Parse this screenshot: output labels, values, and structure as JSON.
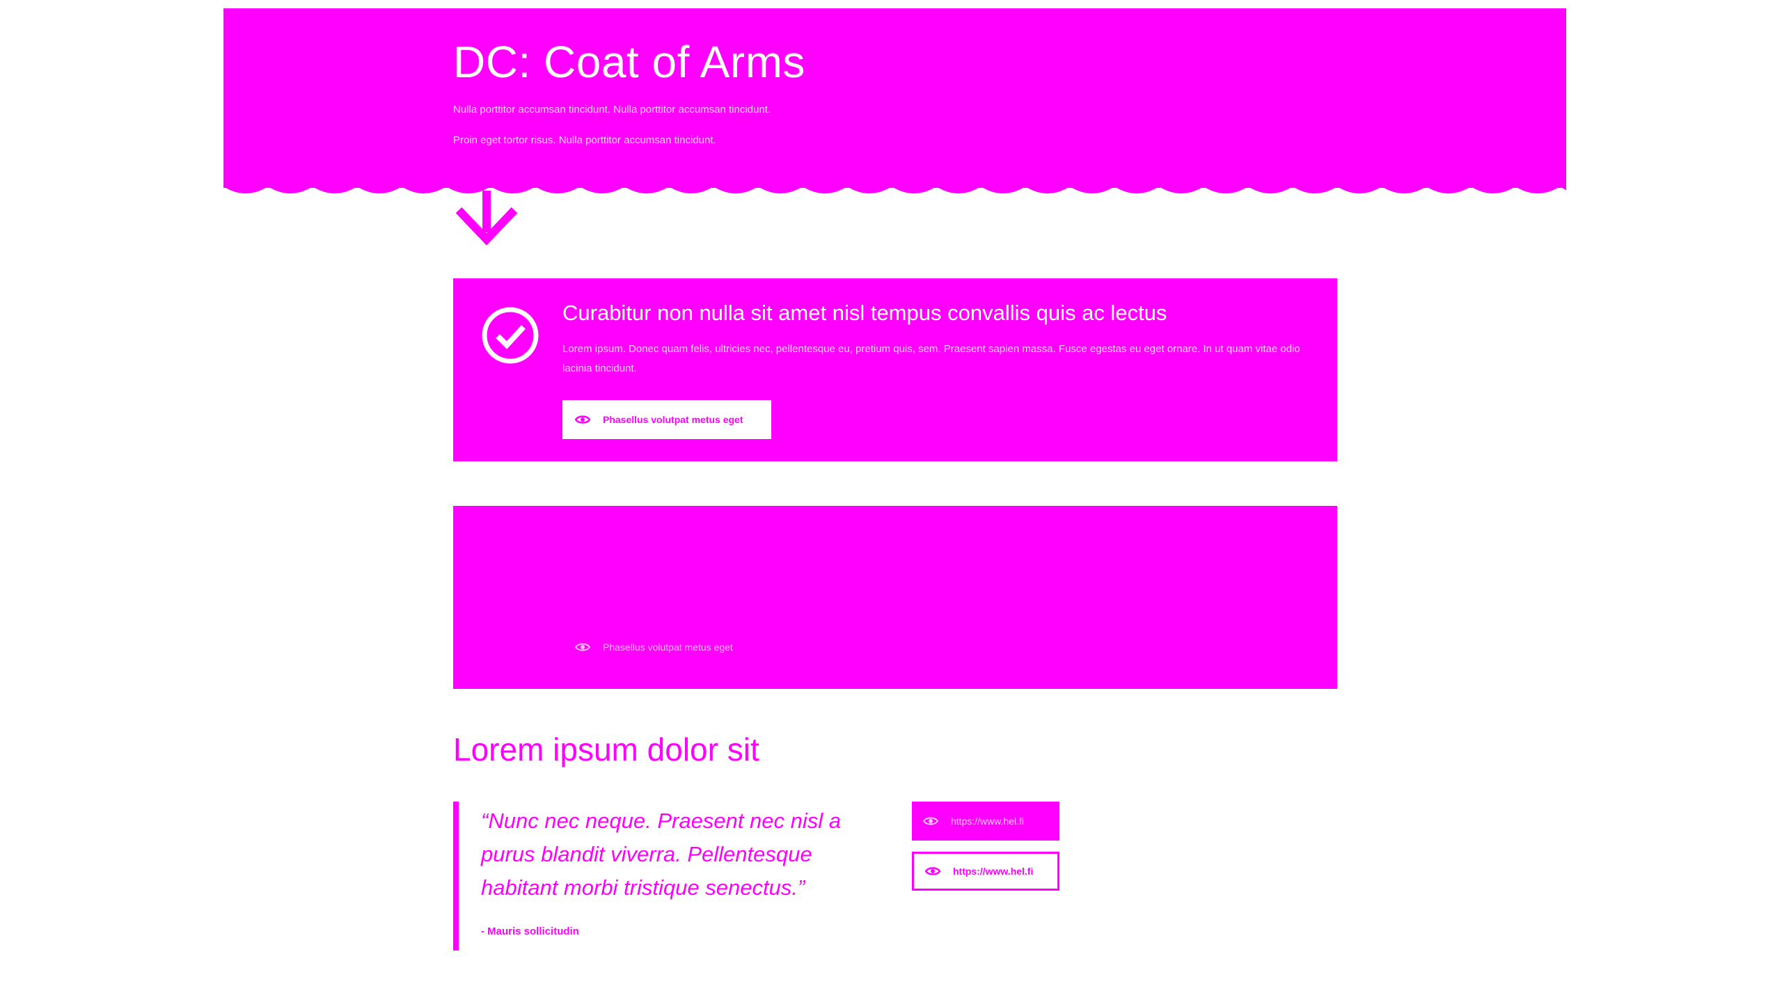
{
  "colors": {
    "brand": "#ff00ff",
    "background": "#ffffff",
    "text_on_brand": "#ffffff"
  },
  "hero": {
    "title": "DC: Coat of Arms",
    "paragraph_1": "Nulla porttitor accumsan tincidunt. Nulla porttitor accumsan tincidunt.",
    "paragraph_2": "Proin eget tortor risus. Nulla porttitor accumsan tincidunt.",
    "scroll_icon": "arrow-down-icon"
  },
  "notification_card": {
    "icon": "check-circle-icon",
    "title": "Curabitur non nulla sit amet nisl tempus convallis quis ac lectus",
    "text": "Lorem ipsum. Donec quam felis, ultricies nec, pellentesque eu, pretium quis, sem. Praesent sapien massa. Fusce egestas eu eget ornare. In ut quam vitae odio lacinia tincidunt.",
    "button_label": "Phasellus volutpat metus eget",
    "button_icon": "eye-icon"
  },
  "empty_card": {
    "button_label": "Phasellus volutpat metus eget",
    "button_icon": "eye-icon"
  },
  "section": {
    "title": "Lorem ipsum dolor sit"
  },
  "quote": {
    "text": "“Nunc nec neque. Praesent nec nisl a purus blandit viverra. Pellentesque habitant morbi tristique senectus.”",
    "author": "- Mauris sollicitudin"
  },
  "links": [
    {
      "label": "https://www.hel.fi",
      "icon": "eye-icon",
      "style": "filled"
    },
    {
      "label": "https://www.hel.fi",
      "icon": "eye-icon",
      "style": "outline"
    }
  ]
}
